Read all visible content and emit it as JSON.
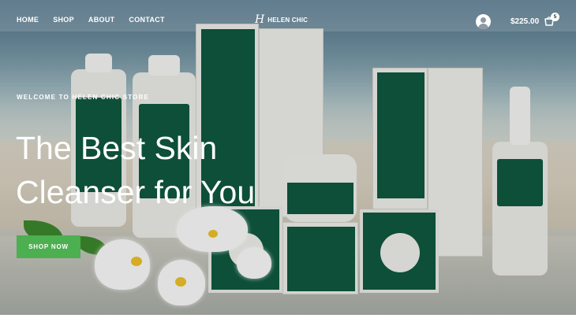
{
  "header": {
    "nav": [
      "HOME",
      "SHOP",
      "ABOUT",
      "CONTACT"
    ],
    "logo_mark": "H",
    "logo_text": "HELEN CHIC",
    "cart_total": "$225.00",
    "cart_count": "5",
    "icons": [
      "account-icon",
      "cart-icon"
    ]
  },
  "hero": {
    "eyebrow": "WELCOME TO HELEN CHIC STORE",
    "headline_line1": "The Best Skin",
    "headline_line2": "Cleanser for You",
    "cta_label": "SHOP NOW"
  },
  "colors": {
    "accent_green": "#4caf50",
    "product_green": "#0f5a40",
    "text_white": "#ffffff"
  }
}
